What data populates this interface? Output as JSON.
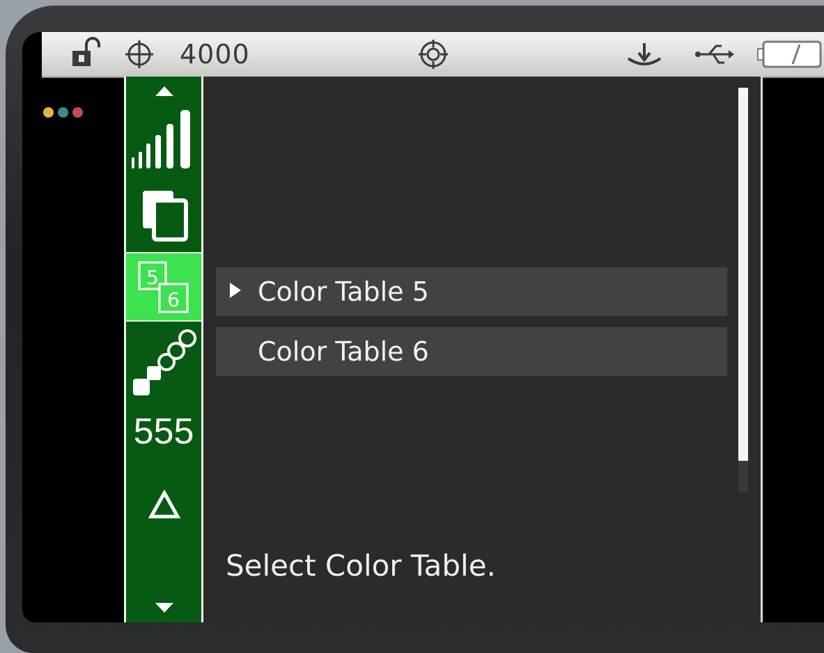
{
  "status_bar": {
    "lock_icon": "unlocked-padlock-icon",
    "target_icon": "crosshair-icon",
    "value": "4000",
    "center_icon": "target-reticle-icon",
    "right_icons": [
      "anchor-icon",
      "usb-icon",
      "battery-icon"
    ]
  },
  "indicator_dots": [
    "#e6b33c",
    "#3f8a80",
    "#c44a55"
  ],
  "sidebar": {
    "items": [
      {
        "icon": "scroll-up-icon"
      },
      {
        "icon": "signal-bars-icon"
      },
      {
        "icon": "copy-pages-icon"
      },
      {
        "icon": "color-table-5-6-icon",
        "selected": true
      },
      {
        "icon": "scatter-squares-circles-icon"
      },
      {
        "label": "555"
      },
      {
        "icon": "delta-icon"
      },
      {
        "icon": "scroll-down-icon"
      }
    ]
  },
  "menu": {
    "items": [
      {
        "label": "Color Table 5",
        "selected": true
      },
      {
        "label": "Color Table 6",
        "selected": false
      }
    ],
    "scroll_fraction_visible": 0.92
  },
  "hint": "Select Color Table.",
  "colors": {
    "sidebar_bg": "#075a12",
    "sidebar_selected": "#3ee24f",
    "content_bg": "#2b2b2b",
    "row_bg": "#424242"
  }
}
